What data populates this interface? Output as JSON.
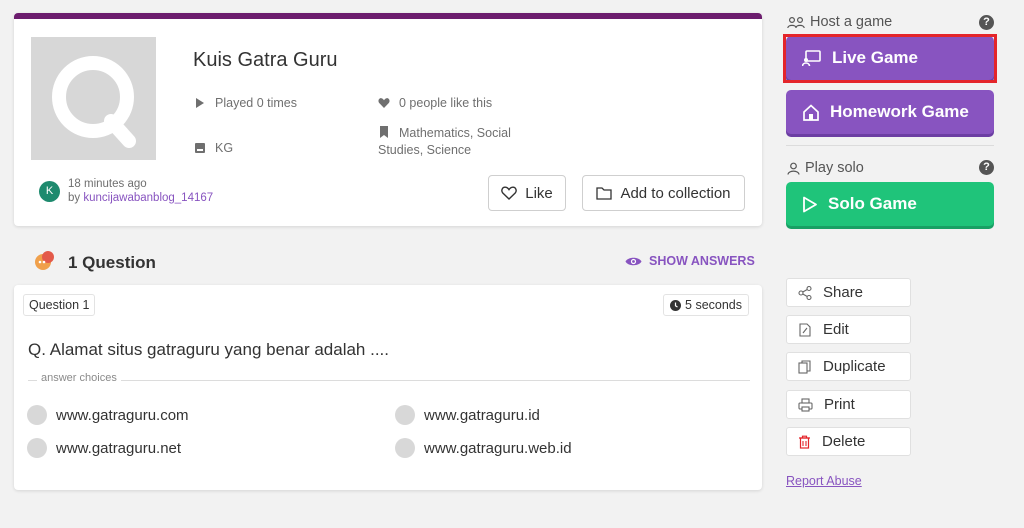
{
  "quiz": {
    "title": "Kuis Gatra Guru",
    "played": "Played 0 times",
    "likes": "0 people like this",
    "grade": "KG",
    "subjects": "Mathematics, Social Studies, Science",
    "author_initial": "K",
    "author_time": "18 minutes ago",
    "author_by": "by",
    "author_name": "kuncijawabanblog_14167",
    "like_button": "Like",
    "collection_button": "Add to collection"
  },
  "questions": {
    "count_label": "1 Question",
    "show_answers": "SHOW ANSWERS",
    "items": [
      {
        "label": "Question 1",
        "time": "5 seconds",
        "text": "Q. Alamat situs gatraguru yang benar adalah ....",
        "choices_label": "answer choices",
        "choices": [
          "www.gatraguru.com",
          "www.gatraguru.id",
          "www.gatraguru.net",
          "www.gatraguru.web.id"
        ]
      }
    ]
  },
  "sidebar": {
    "host_label": "Host a game",
    "help": "?",
    "live_game": "Live Game",
    "homework_game": "Homework Game",
    "solo_label": "Play solo",
    "solo_game": "Solo Game",
    "actions": {
      "share": "Share",
      "edit": "Edit",
      "duplicate": "Duplicate",
      "print": "Print",
      "delete": "Delete"
    },
    "report": "Report Abuse"
  },
  "colors": {
    "accent": "#8854c0",
    "solo": "#1fc47a",
    "topbar": "#6c1d6e",
    "highlight": "#e4252b",
    "delete": "#e4252b"
  }
}
